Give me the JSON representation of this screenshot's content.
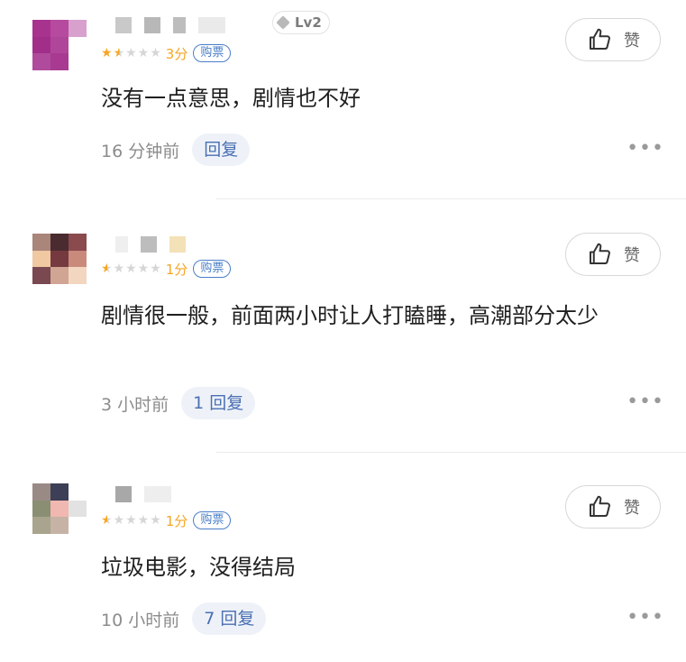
{
  "like_label": "赞",
  "more_glyph": "•••",
  "comments": [
    {
      "level": "Lv2",
      "score": "3分",
      "ticket": "购票",
      "text": "没有一点意思，剧情也不好",
      "time": "16 分钟前",
      "reply": "回复"
    },
    {
      "score": "1分",
      "ticket": "购票",
      "text": "剧情很一般，前面两小时让人打瞌睡，高潮部分太少",
      "time": "3 小时前",
      "reply": "1 回复"
    },
    {
      "score": "1分",
      "ticket": "购票",
      "text": "垃圾电影，没得结局",
      "time": "10 小时前",
      "reply": "7 回复"
    }
  ],
  "colors": {
    "star": "#f5a623",
    "link": "#4a7fc8",
    "reply": "#4a6fb3"
  }
}
